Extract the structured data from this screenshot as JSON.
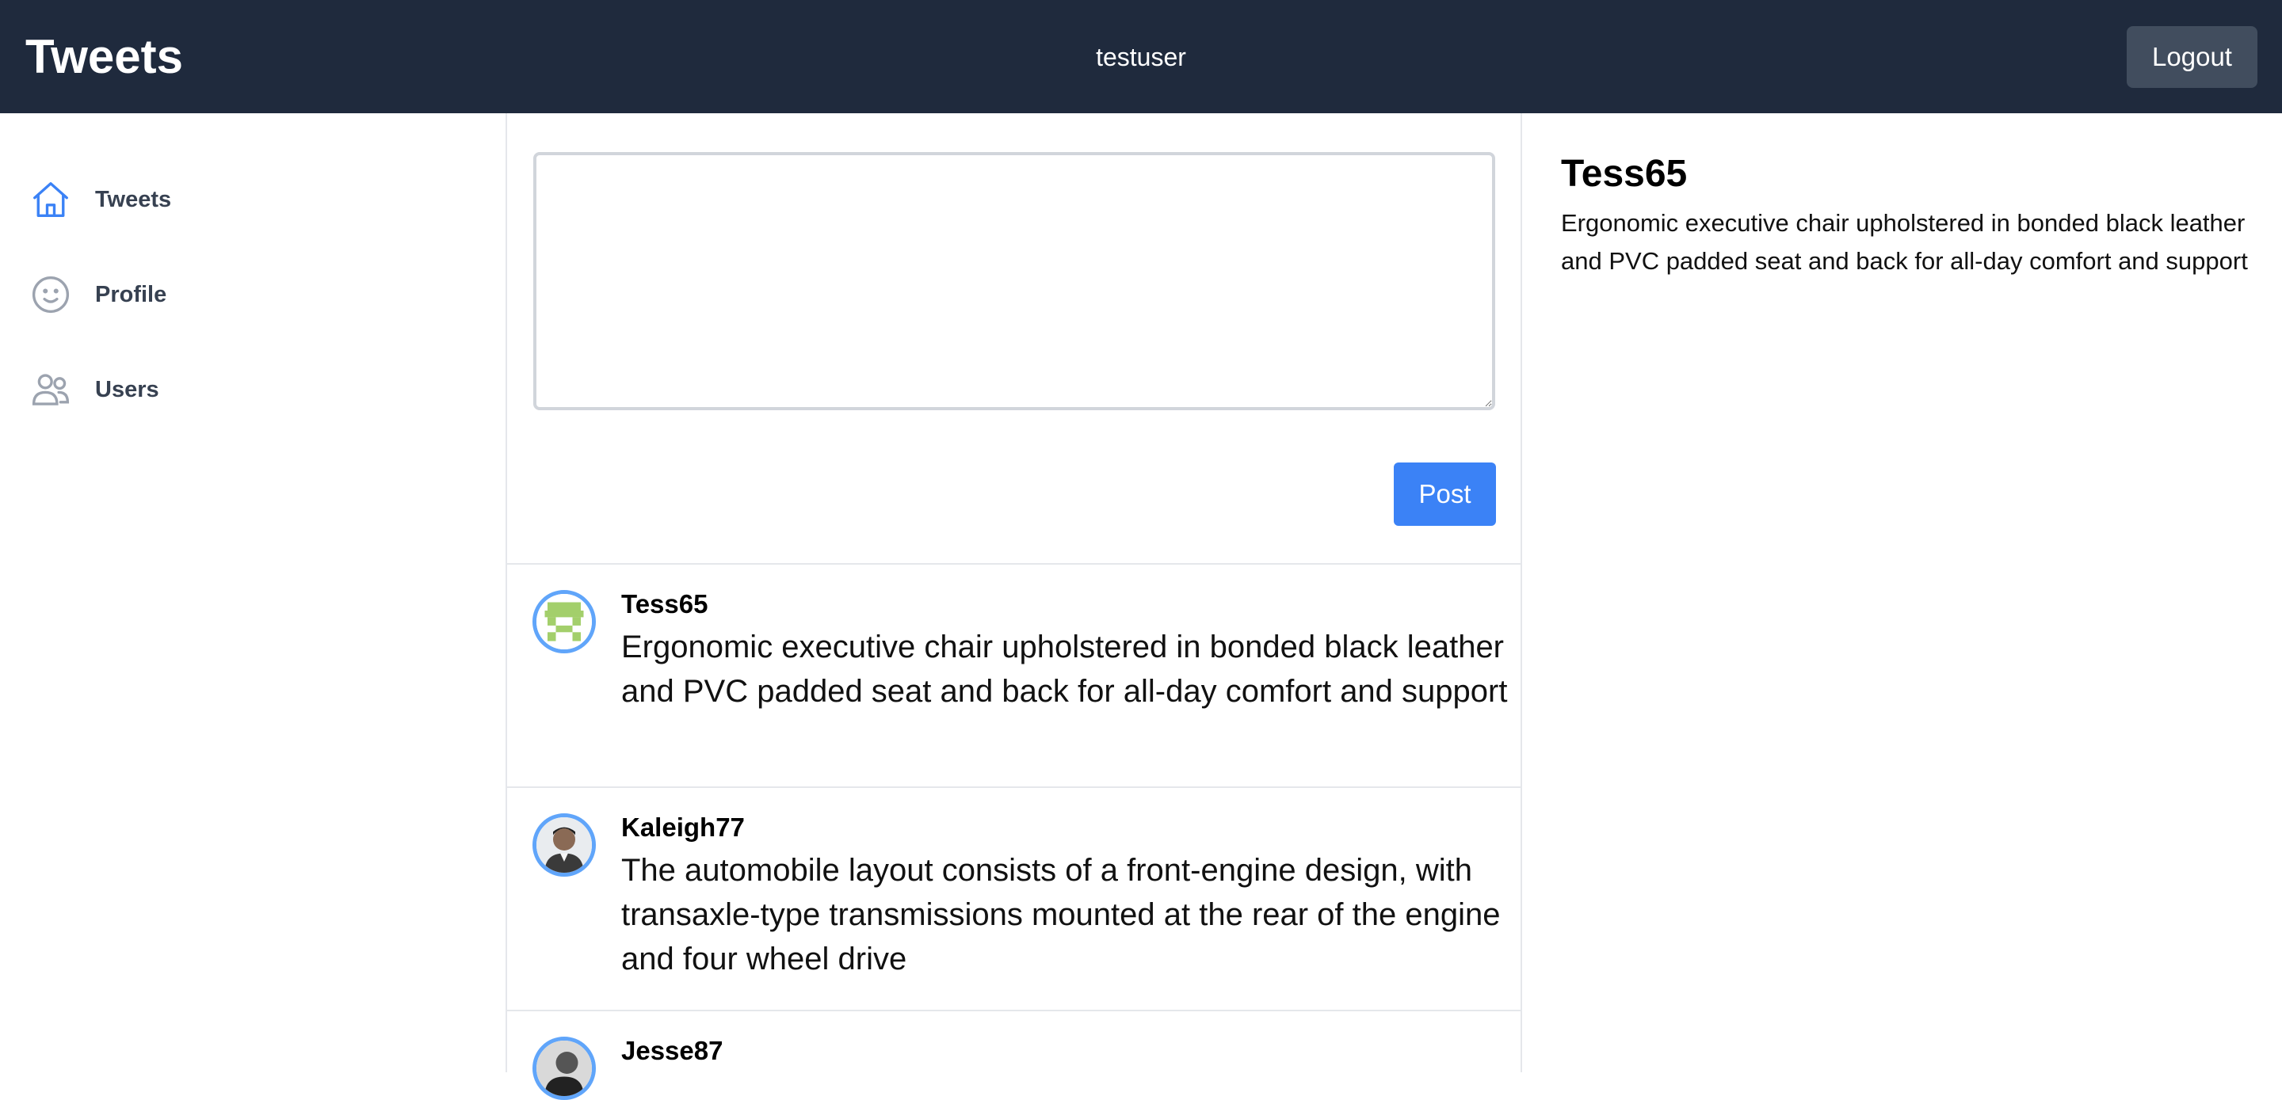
{
  "header": {
    "brand": "Tweets",
    "username": "testuser",
    "logout_label": "Logout"
  },
  "sidebar": {
    "items": [
      {
        "label": "Tweets",
        "icon": "home-icon",
        "active": true
      },
      {
        "label": "Profile",
        "icon": "smiley-icon",
        "active": false
      },
      {
        "label": "Users",
        "icon": "users-icon",
        "active": false
      }
    ]
  },
  "composer": {
    "value": "",
    "placeholder": "",
    "post_label": "Post"
  },
  "tweets": [
    {
      "author": "Tess65",
      "text": "Ergonomic executive chair upholstered in bonded black leather and PVC padded seat and back for all-day comfort and support",
      "avatar": "identicon-avatar"
    },
    {
      "author": "Kaleigh77",
      "text": "The automobile layout consists of a front-engine design, with transaxle-type transmissions mounted at the rear of the engine and four wheel drive",
      "avatar": "photo-avatar"
    },
    {
      "author": "Jesse87",
      "text": "",
      "avatar": "photo-avatar"
    }
  ],
  "detail": {
    "author": "Tess65",
    "text": "Ergonomic executive chair upholstered in bonded black leather and PVC padded seat and back for all-day comfort and support"
  },
  "colors": {
    "header_bg": "#1f2a3d",
    "accent": "#3b82f6",
    "avatar_ring": "#60a5fa",
    "logout_bg": "#414d5e"
  }
}
